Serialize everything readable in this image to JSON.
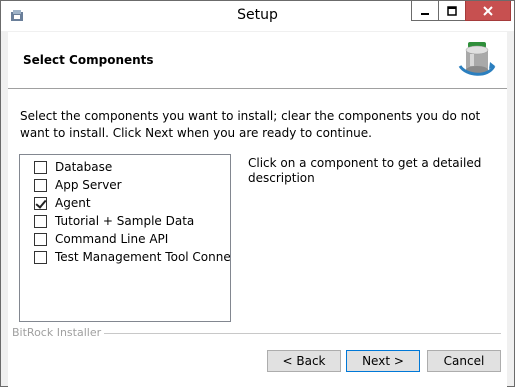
{
  "window": {
    "title": "Setup"
  },
  "header": {
    "title": "Select Components"
  },
  "instructions": "Select the components you want to install; clear the components you do not want to install. Click Next when you are ready to continue.",
  "components": [
    {
      "label": "Database",
      "checked": false
    },
    {
      "label": "App Server",
      "checked": false
    },
    {
      "label": "Agent",
      "checked": true
    },
    {
      "label": "Tutorial + Sample Data",
      "checked": false
    },
    {
      "label": "Command Line API",
      "checked": false
    },
    {
      "label": "Test Management Tool Connector",
      "checked": false
    }
  ],
  "description": "Click on a component to get a detailed description",
  "footer": {
    "label": "BitRock Installer"
  },
  "buttons": {
    "back": "< Back",
    "next": "Next >",
    "cancel": "Cancel"
  },
  "colors": {
    "close_button": "#c75050",
    "focus_border": "#0078d7"
  }
}
